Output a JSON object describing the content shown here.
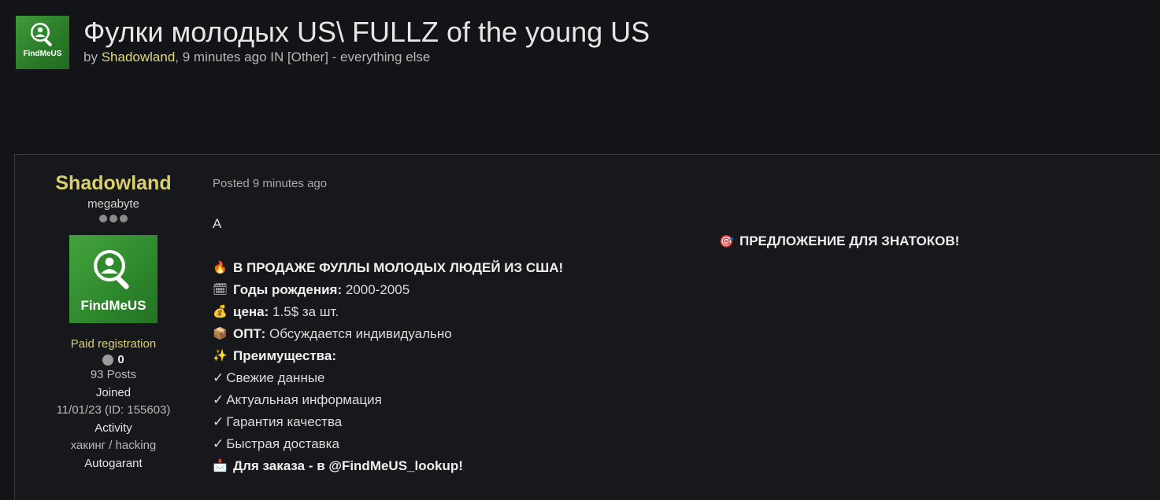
{
  "header": {
    "avatar_brand": "FindMeUS",
    "title": "Фулки молодых US\\ FULLZ of the young US",
    "by": "by",
    "author": "Shadowland",
    "meta_rest": ", 9 minutes ago IN [Other] - everything else"
  },
  "author": {
    "name": "Shadowland",
    "rank": "megabyte",
    "avatar_brand": "FindMeUS",
    "group": "Paid registration",
    "reputation": "0",
    "posts": "93 Posts",
    "joined_label": "Joined",
    "joined_value": "11/01/23 (ID: 155603)",
    "activity_label": "Activity",
    "activity_value": "хакинг / hacking",
    "autogarant_label": "Autogarant"
  },
  "post": {
    "posted": "Posted 9 minutes ago",
    "first_line": "A",
    "headline": "В ПРОДАЖЕ ФУЛЛЫ МОЛОДЫХ ЛЮДЕЙ ИЗ США!",
    "years_label": "Годы рождения:",
    "years_value": "2000-2005",
    "price_label": "цена:",
    "price_value": "1.5$ за шт.",
    "opt_label": "ОПТ:",
    "opt_value": "Обсуждается индивидуально",
    "advantages_label": "Преимущества:",
    "advantages": [
      "Свежие данные",
      "Актуальная информация",
      "Гарантия качества",
      "Быстрая доставка"
    ],
    "order": "Для заказа - в @FindMeUS_lookup!",
    "offer": "ПРЕДЛОЖЕНИЕ ДЛЯ ЗНАТОКОВ!"
  },
  "icons": {
    "headline": "fire-icon",
    "years": "calendar-icon",
    "price": "money-bag-icon",
    "opt": "package-icon",
    "advantages": "sparkles-icon",
    "order": "inbox-icon",
    "offer": "target-icon"
  },
  "colors": {
    "background": "#131417",
    "author_name": "#d9cf6f",
    "avatar_green": "#2f8a2d"
  }
}
